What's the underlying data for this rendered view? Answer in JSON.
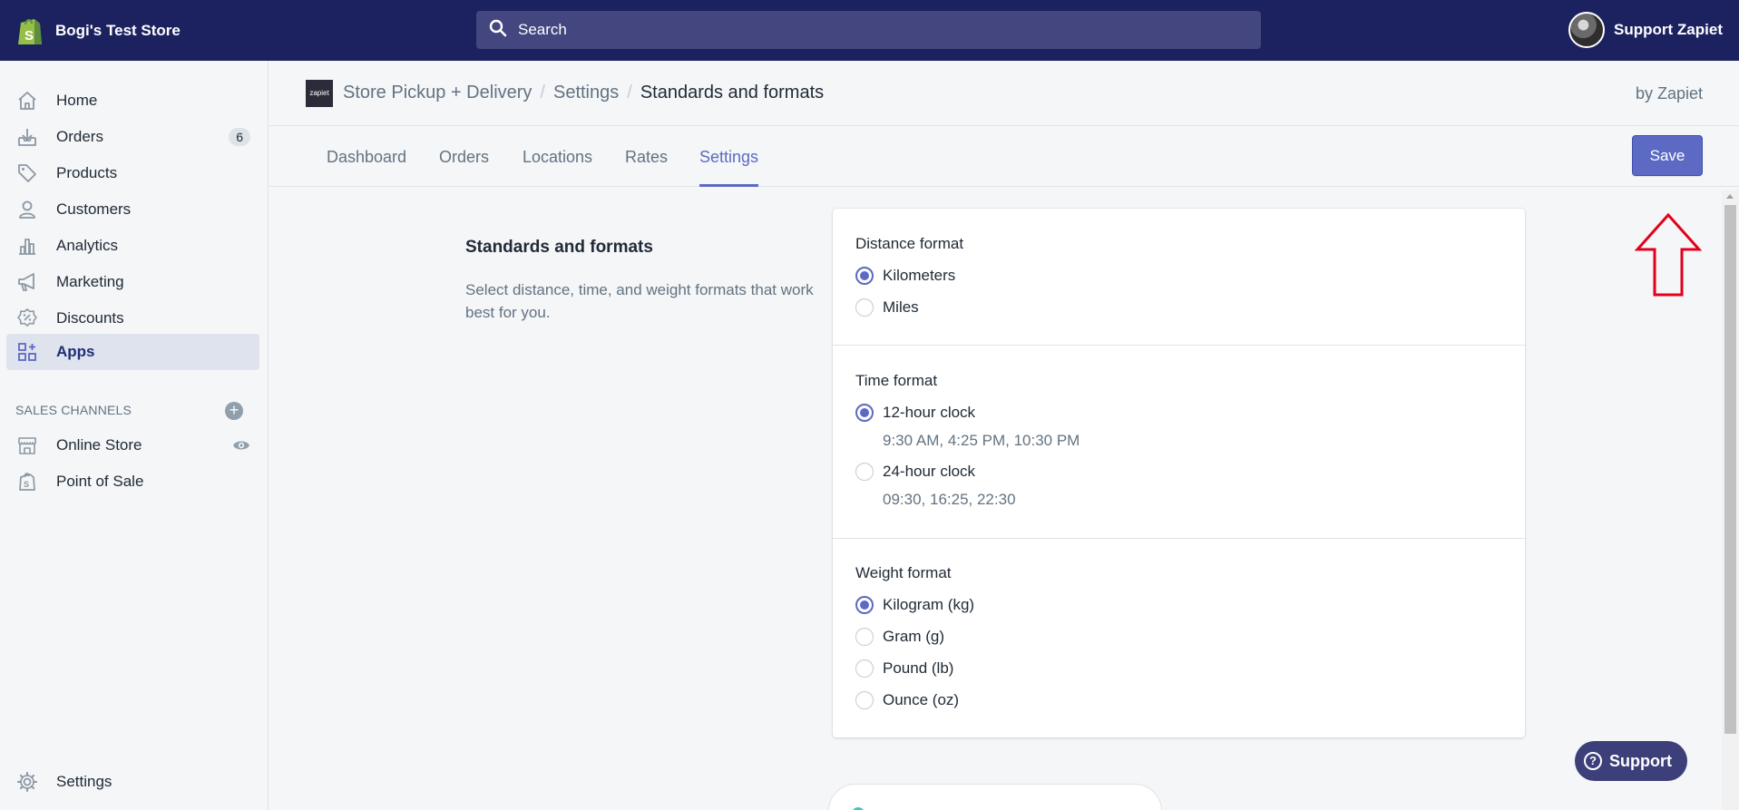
{
  "topbar": {
    "store_name": "Bogi's Test Store",
    "search_placeholder": "Search",
    "account_name": "Support Zapiet"
  },
  "sidebar": {
    "items": [
      {
        "label": "Home",
        "icon": "home-icon"
      },
      {
        "label": "Orders",
        "icon": "orders-icon",
        "badge": "6"
      },
      {
        "label": "Products",
        "icon": "tag-icon"
      },
      {
        "label": "Customers",
        "icon": "person-icon"
      },
      {
        "label": "Analytics",
        "icon": "bar-chart-icon"
      },
      {
        "label": "Marketing",
        "icon": "megaphone-icon"
      },
      {
        "label": "Discounts",
        "icon": "discount-icon"
      },
      {
        "label": "Apps",
        "icon": "apps-icon",
        "active": true
      }
    ],
    "sales_channels_label": "SALES CHANNELS",
    "channels": [
      {
        "label": "Online Store",
        "icon": "store-icon"
      },
      {
        "label": "Point of Sale",
        "icon": "pos-bag-icon"
      }
    ],
    "settings_label": "Settings"
  },
  "breadcrumb": {
    "app_logo_text": "zapiet",
    "items": [
      "Store Pickup + Delivery",
      "Settings",
      "Standards and formats"
    ],
    "by": "by Zapiet"
  },
  "tabs": [
    "Dashboard",
    "Orders",
    "Locations",
    "Rates",
    "Settings"
  ],
  "active_tab": "Settings",
  "save_label": "Save",
  "section": {
    "title": "Standards and formats",
    "description": "Select distance, time, and weight formats that work best for you."
  },
  "distance": {
    "label": "Distance format",
    "options": [
      {
        "label": "Kilometers",
        "checked": true
      },
      {
        "label": "Miles",
        "checked": false
      }
    ]
  },
  "time": {
    "label": "Time format",
    "options": [
      {
        "label": "12-hour clock",
        "help": "9:30 AM, 4:25 PM, 10:30 PM",
        "checked": true
      },
      {
        "label": "24-hour clock",
        "help": "09:30, 16:25, 22:30",
        "checked": false
      }
    ]
  },
  "weight": {
    "label": "Weight format",
    "options": [
      {
        "label": "Kilogram (kg)",
        "checked": true
      },
      {
        "label": "Gram (g)",
        "checked": false
      },
      {
        "label": "Pound (lb)",
        "checked": false
      },
      {
        "label": "Ounce (oz)",
        "checked": false
      }
    ]
  },
  "support_label": "Support",
  "colors": {
    "topbar": "#1c2260",
    "accent": "#5c6ac4",
    "annotation_arrow": "#e3001b"
  }
}
